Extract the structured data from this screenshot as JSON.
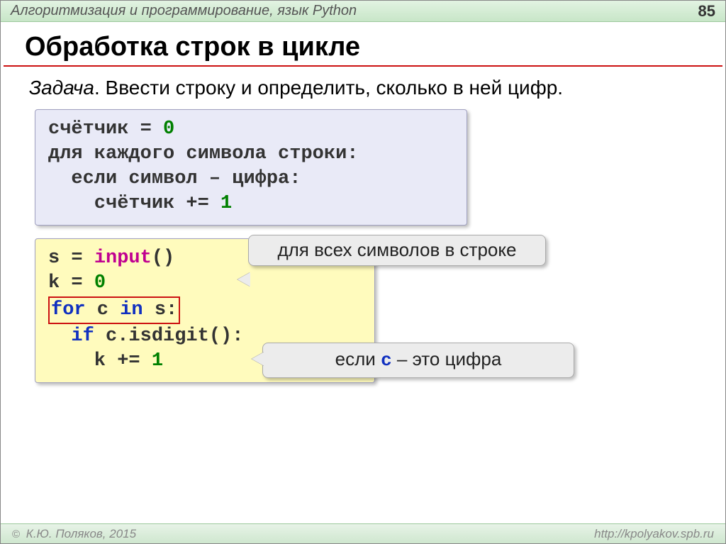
{
  "header": {
    "breadcrumb": "Алгоритмизация и программирование, язык Python",
    "page": "85"
  },
  "title": "Обработка строк в цикле",
  "task": {
    "label": "Задача",
    "text": ". Ввести строку и определить, сколько в ней цифр."
  },
  "pseudo": {
    "l1a": "счётчик = ",
    "l1b": "0",
    "l2": "для каждого символа строки:",
    "l3": "  если символ – цифра:",
    "l4a": "    счётчик += ",
    "l4b": "1"
  },
  "code": {
    "l1a": "s = ",
    "l1b": "input",
    "l1c": "()",
    "l2a": "k = ",
    "l2b": "0",
    "l3a": "for",
    "l3b": " c ",
    "l3c": "in",
    "l3d": " s:",
    "l4a": "  ",
    "l4b": "if",
    "l4c": " c.isdigit():",
    "l5a": "    k += ",
    "l5b": "1"
  },
  "callouts": {
    "c1": "для всех символов в строке",
    "c2a": "если ",
    "c2b": "c",
    "c2c": " – это цифра"
  },
  "footer": {
    "copyright": "К.Ю. Поляков, 2015",
    "url": "http://kpolyakov.spb.ru"
  }
}
